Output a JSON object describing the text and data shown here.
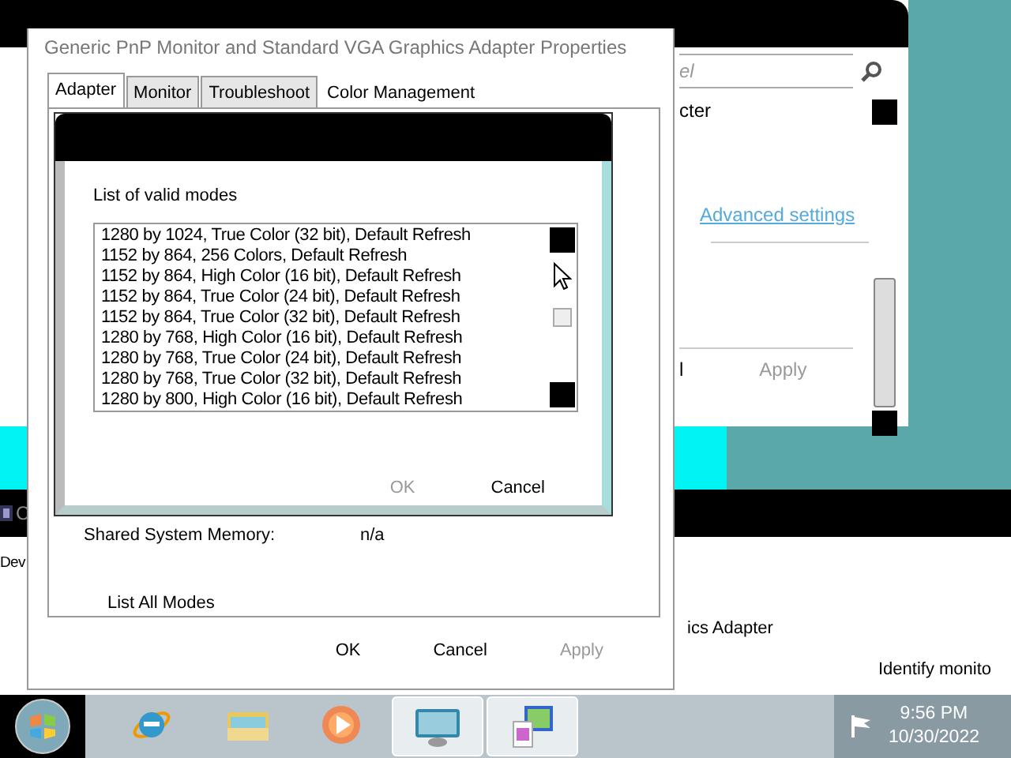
{
  "background_window": {
    "search_placeholder": "el",
    "partial_text": "cter",
    "link": "Advanced settings",
    "partial_button": "l",
    "apply_button": {
      "label": "Apply",
      "disabled": true
    }
  },
  "lower_window": {
    "header_text": "C",
    "texts": [
      "Dev",
      "ics Adapter",
      "Identify monito"
    ]
  },
  "dialog": {
    "title": "Generic PnP Monitor and Standard VGA Graphics Adapter Properties",
    "tabs": [
      {
        "label": "Adapter",
        "selected": true
      },
      {
        "label": "Monitor",
        "selected": false
      },
      {
        "label": "Troubleshoot",
        "selected": false
      },
      {
        "label": "Color Management",
        "selected": false
      }
    ],
    "modes_dialog": {
      "label": "List of valid modes",
      "modes": [
        "1280 by 1024, True Color (32 bit), Default Refresh",
        "1152 by 864, 256 Colors, Default Refresh",
        "1152 by 864, High Color (16 bit), Default Refresh",
        "1152 by 864, True Color (24 bit), Default Refresh",
        "1152 by 864, True Color (32 bit), Default Refresh",
        "1280 by 768, High Color (16 bit), Default Refresh",
        "1280 by 768, True Color (24 bit), Default Refresh",
        "1280 by 768, True Color (32 bit), Default Refresh",
        "1280 by 800, High Color (16 bit), Default Refresh"
      ],
      "buttons": [
        {
          "label": "OK",
          "disabled": true
        },
        {
          "label": "Cancel",
          "disabled": false
        }
      ]
    },
    "memory_label": "Shared System Memory:",
    "memory_value": "n/a",
    "list_all_modes": "List All Modes",
    "buttons": [
      {
        "label": "OK",
        "disabled": false
      },
      {
        "label": "Cancel",
        "disabled": false
      },
      {
        "label": "Apply",
        "disabled": true
      }
    ]
  },
  "taskbar": {
    "items": [
      {
        "kind": "browser",
        "active": false
      },
      {
        "kind": "folder",
        "active": false
      },
      {
        "kind": "media",
        "active": false
      },
      {
        "kind": "display",
        "active": true
      },
      {
        "kind": "colors",
        "active": true
      }
    ],
    "time": "9:56 PM",
    "date": "10/30/2022"
  }
}
